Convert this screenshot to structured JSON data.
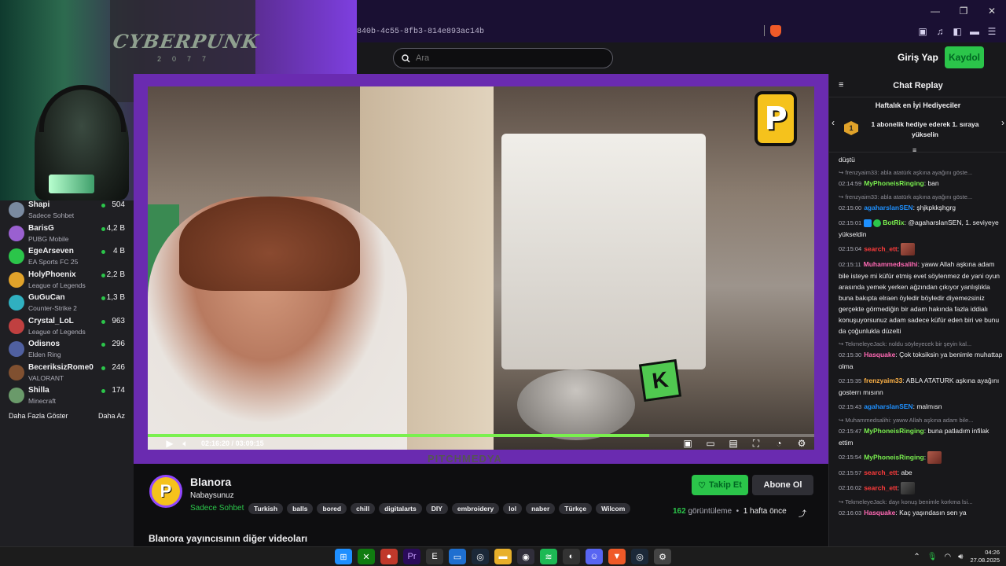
{
  "browser": {
    "url_fragment": "840b-4c55-8fb3-814e893ac14b",
    "window_controls": [
      "—",
      "❐",
      "✕"
    ]
  },
  "header": {
    "search_placeholder": "Ara",
    "login_label": "Giriş Yap",
    "signup_label": "Kaydol"
  },
  "webcam": {
    "poster_text": "CYBERPUNK",
    "poster_num": "2077"
  },
  "sidebar": {
    "channels": [
      {
        "name": "Shapi",
        "game": "Sadece Sohbet",
        "viewers": "504",
        "color": "#7a8aa0"
      },
      {
        "name": "BarisG",
        "game": "PUBG Mobile",
        "viewers": "4,2 B",
        "color": "#9a60d0"
      },
      {
        "name": "EgeArseven",
        "game": "EA Sports FC 25",
        "viewers": "4 B",
        "color": "#2bc54a"
      },
      {
        "name": "HolyPhoenix",
        "game": "League of Legends",
        "viewers": "2,2 B",
        "color": "#e0a22a"
      },
      {
        "name": "GuGuCan",
        "game": "Counter-Strike 2",
        "viewers": "1,3 B",
        "color": "#30b0c0"
      },
      {
        "name": "Crystal_LoL",
        "game": "League of Legends",
        "viewers": "963",
        "color": "#c04040"
      },
      {
        "name": "Odisnos",
        "game": "Elden Ring",
        "viewers": "296",
        "color": "#5060a0"
      },
      {
        "name": "BeceriksizRome0",
        "game": "VALORANT",
        "viewers": "246",
        "color": "#805030"
      },
      {
        "name": "Shilla",
        "game": "Minecraft",
        "viewers": "174",
        "color": "#6a9a6a"
      }
    ],
    "show_more": "Daha Fazla Göster",
    "show_less": "Daha Az"
  },
  "player": {
    "time_current": "02:16:20",
    "time_sep": "/",
    "time_total": "03:09:15",
    "progress": 0.752,
    "watermark": "PITCHMEDYA"
  },
  "channel": {
    "name": "Blanora",
    "title": "Nabaysunuz",
    "category": "Sadece Sohbet",
    "tags": [
      "Turkish",
      "balls",
      "bored",
      "chill",
      "digitalarts",
      "DIY",
      "embroidery",
      "lol",
      "naber",
      "Türkçe",
      "Wilcom"
    ],
    "follow_label": "Takip Et",
    "subscribe_label": "Abone Ol",
    "views_count": "162",
    "views_label": "görüntüleme",
    "bullet": "•",
    "age": "1 hafta önce",
    "other_videos": "Blanora yayıncısının diğer videoları"
  },
  "chat": {
    "title": "Chat Replay",
    "gifters_title": "Haftalık en İyi Hediyeciler",
    "gifters_desc": "1 abonelik hediye ederek 1. sıraya yükselin",
    "gifters_rank": "1",
    "messages": [
      {
        "type": "text",
        "text": "düştü"
      },
      {
        "type": "reply",
        "text": "frenzyaim33: abla atatürk aşkına ayağını göste..."
      },
      {
        "type": "msg",
        "ts": "02:14:59",
        "user": "MyPhoneisRinging",
        "color": "#7af04f",
        "text": "ban"
      },
      {
        "type": "reply",
        "text": "frenzyaim33: abla atatürk aşkına ayağını göste..."
      },
      {
        "type": "msg",
        "ts": "02:15:00",
        "user": "agaharslanSEN",
        "color": "#1e90ff",
        "text": "şhjkpkkşhgrg"
      },
      {
        "type": "msg",
        "ts": "02:15:01",
        "user": "BotRix",
        "color": "#7af04f",
        "text": "@agaharslanSEN, 1. seviyeye yükseldin"
      },
      {
        "type": "msg",
        "ts": "02:15:04",
        "user": "search_ett",
        "color": "#ff3b3b",
        "text": "",
        "emote": "red"
      },
      {
        "type": "msg",
        "ts": "02:15:11",
        "user": "Muhammedsalihi",
        "color": "#ff69b4",
        "text": "yaww Allah aşkına adam bile isteye mi küfür etmiş evet söylenmez de yani oyun arasında yemek yerken ağzından çıkıyor yanlışlıkla buna bakıpta elraen öyledir böyledir diyemezsiniz gerçekte görmediğin bir adam hakında fazla iddialı konuşuyorsunuz adam sadece küfür eden biri ve bunu da çoğunlukla düzelti"
      },
      {
        "type": "reply",
        "text": "TekmeleyeJack: noldu söyleyecek bir şeyin kal..."
      },
      {
        "type": "msg",
        "ts": "02:15:30",
        "user": "Hasquake",
        "color": "#ff69b4",
        "text": "Çok toksiksin ya benimle muhattap olma"
      },
      {
        "type": "msg",
        "ts": "02:15:35",
        "user": "frenzyaim33",
        "color": "#ffb347",
        "text": "ABLA ATATURK aşkına ayağını gosterrı mısınn"
      },
      {
        "type": "msg",
        "ts": "02:15:43",
        "user": "agaharslanSEN",
        "color": "#1e90ff",
        "text": "malmısn"
      },
      {
        "type": "reply",
        "text": "Muhammedsalihi: yaww Allah aşkına adam bile..."
      },
      {
        "type": "msg",
        "ts": "02:15:47",
        "user": "MyPhoneisRinging",
        "color": "#7af04f",
        "text": "buna patladım infilak ettim"
      },
      {
        "type": "msg",
        "ts": "02:15:54",
        "user": "MyPhoneisRinging",
        "color": "#7af04f",
        "text": "",
        "emote": "red"
      },
      {
        "type": "msg",
        "ts": "02:15:57",
        "user": "search_ett",
        "color": "#ff3b3b",
        "text": "abe"
      },
      {
        "type": "msg",
        "ts": "02:16:02",
        "user": "search_ett",
        "color": "#ff3b3b",
        "text": "",
        "emote": "dark"
      },
      {
        "type": "reply",
        "text": "TekmeleyeJack: dayı konuş benimle korkma lsi..."
      },
      {
        "type": "msg",
        "ts": "02:16:03",
        "user": "Hasquake",
        "color": "#ff69b4",
        "text": "Kaç yaşındasın sen ya"
      }
    ]
  },
  "taskbar": {
    "time": "04:26",
    "date": "27.08.2025"
  },
  "colors": {
    "accent_green": "#2bc54a",
    "player_frame": "#6a2bb0",
    "progress": "#7af04f"
  }
}
